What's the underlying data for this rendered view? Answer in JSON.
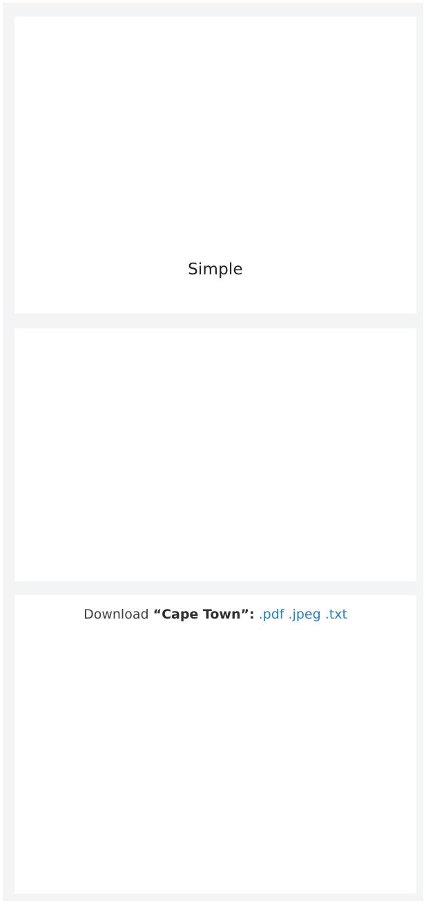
{
  "panel_top": {
    "label": "Simple"
  },
  "download": {
    "prefix": "Download",
    "city": "“Cape Town”:",
    "links": {
      "pdf": ".pdf",
      "jpeg": ".jpeg",
      "txt": ".txt"
    }
  },
  "colors": {
    "page_background": "#f3f4f6",
    "panel_background": "#ffffff",
    "link": "#2a7cc4",
    "text": "#3d3d3d"
  }
}
